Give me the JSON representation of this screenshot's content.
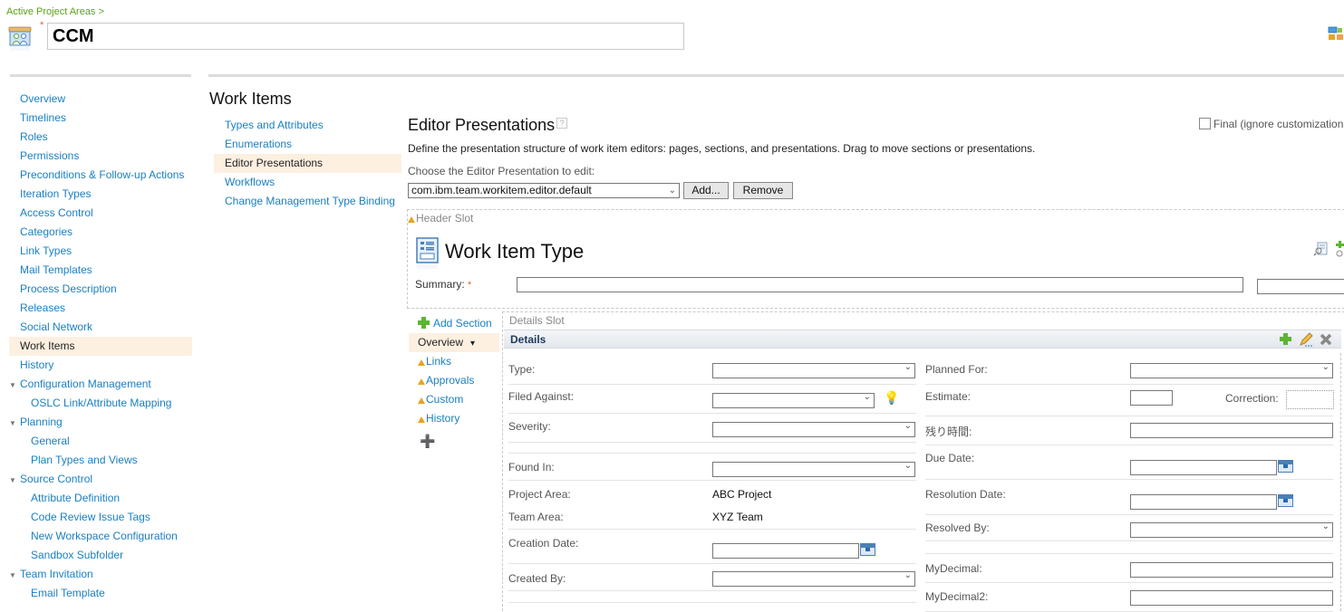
{
  "breadcrumb": "Active Project Areas >",
  "project": {
    "name": "CCM",
    "required_marker": "*"
  },
  "sidebar": {
    "items": [
      {
        "label": "Overview",
        "level": 0
      },
      {
        "label": "Timelines",
        "level": 0
      },
      {
        "label": "Roles",
        "level": 0
      },
      {
        "label": "Permissions",
        "level": 0
      },
      {
        "label": "Preconditions & Follow-up Actions",
        "level": 0
      },
      {
        "label": "Iteration Types",
        "level": 0
      },
      {
        "label": "Access Control",
        "level": 0
      },
      {
        "label": "Categories",
        "level": 0
      },
      {
        "label": "Link Types",
        "level": 0
      },
      {
        "label": "Mail Templates",
        "level": 0
      },
      {
        "label": "Process Description",
        "level": 0
      },
      {
        "label": "Releases",
        "level": 0
      },
      {
        "label": "Social Network",
        "level": 0
      },
      {
        "label": "Work Items",
        "level": 0,
        "selected": true
      },
      {
        "label": "History",
        "level": 0
      },
      {
        "label": "Configuration Management",
        "level": 0,
        "expanded": true
      },
      {
        "label": "OSLC Link/Attribute Mapping",
        "level": 1
      },
      {
        "label": "Planning",
        "level": 0,
        "expanded": true
      },
      {
        "label": "General",
        "level": 1
      },
      {
        "label": "Plan Types and Views",
        "level": 1
      },
      {
        "label": "Source Control",
        "level": 0,
        "expanded": true
      },
      {
        "label": "Attribute Definition",
        "level": 1
      },
      {
        "label": "Code Review Issue Tags",
        "level": 1
      },
      {
        "label": "New Workspace Configuration",
        "level": 1
      },
      {
        "label": "Sandbox Subfolder",
        "level": 1
      },
      {
        "label": "Team Invitation",
        "level": 0,
        "expanded": true
      },
      {
        "label": "Email Template",
        "level": 1
      }
    ]
  },
  "work_items": {
    "title": "Work Items",
    "subnav": [
      {
        "label": "Types and Attributes"
      },
      {
        "label": "Enumerations"
      },
      {
        "label": "Editor Presentations",
        "selected": true
      },
      {
        "label": "Workflows"
      },
      {
        "label": "Change Management Type Binding"
      }
    ]
  },
  "editor": {
    "title": "Editor Presentations",
    "help": "?",
    "description": "Define the presentation structure of work item editors: pages, sections, and presentations. Drag to move sections or presentations.",
    "final_checkbox": {
      "label": "Final (ignore customization",
      "checked": false
    },
    "choose_label": "Choose the Editor Presentation to edit:",
    "selected_presentation": "com.ibm.team.workitem.editor.default",
    "add_button": "Add...",
    "remove_button": "Remove",
    "header_slot_label": "Header Slot",
    "work_item_type_title": "Work Item Type",
    "summary_label": "Summary:",
    "required_marker": "*",
    "add_section": "Add Section",
    "pages": [
      {
        "label": "Overview",
        "selected": true,
        "dropdown": true
      },
      {
        "label": "Links",
        "warning": true
      },
      {
        "label": "Approvals",
        "warning": true
      },
      {
        "label": "Custom",
        "warning": true
      },
      {
        "label": "History",
        "warning": true
      }
    ],
    "details_slot_label": "Details Slot",
    "details_section_title": "Details",
    "left_fields": [
      {
        "label": "Type:",
        "kind": "select",
        "value": ""
      },
      {
        "label": "Filed Against:",
        "kind": "select-assist",
        "value": ""
      },
      {
        "label": "Severity:",
        "kind": "select",
        "value": ""
      },
      {
        "label": "",
        "kind": "spacer"
      },
      {
        "label": "Found In:",
        "kind": "select",
        "value": ""
      },
      {
        "label": "Project Area:",
        "kind": "readonly",
        "value": "ABC Project"
      },
      {
        "label": "Team Area:",
        "kind": "readonly",
        "value": "XYZ Team"
      },
      {
        "label": "Creation Date:",
        "kind": "date",
        "value": ""
      },
      {
        "label": "Created By:",
        "kind": "select",
        "value": ""
      }
    ],
    "right_fields": [
      {
        "label": "Planned For:",
        "kind": "select",
        "value": ""
      },
      {
        "label": "Estimate:",
        "kind": "estimate",
        "value": "",
        "correction_label": "Correction:",
        "correction_value": ""
      },
      {
        "label": "残り時間:",
        "kind": "text",
        "value": ""
      },
      {
        "label": "Due Date:",
        "kind": "date",
        "value": ""
      },
      {
        "label": "Resolution Date:",
        "kind": "date",
        "value": ""
      },
      {
        "label": "Resolved By:",
        "kind": "select",
        "value": ""
      },
      {
        "label": "",
        "kind": "spacer"
      },
      {
        "label": "MyDecimal:",
        "kind": "text",
        "value": ""
      },
      {
        "label": "MyDecimal2:",
        "kind": "text",
        "value": ""
      }
    ]
  }
}
